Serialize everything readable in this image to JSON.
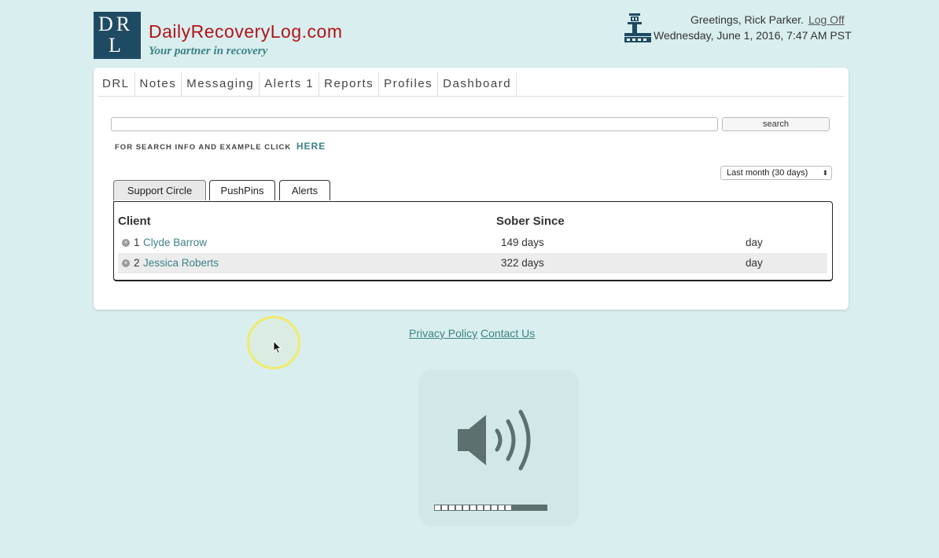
{
  "header": {
    "logo_line1": "DR",
    "logo_line2": "L",
    "brand": "DailyRecoveryLog.com",
    "tagline": "Your partner in recovery",
    "greeting": "Greetings, Rick Parker.",
    "logoff_label": "Log Off",
    "datetime": "Wednesday, June 1, 2016, 7:47 AM PST",
    "icon": "control-tower-icon"
  },
  "nav": {
    "items": [
      {
        "label": "DRL"
      },
      {
        "label": "Notes"
      },
      {
        "label": "Messaging"
      },
      {
        "label": "Alerts 1"
      },
      {
        "label": "Reports"
      },
      {
        "label": "Profiles"
      },
      {
        "label": "Dashboard"
      }
    ]
  },
  "search": {
    "value": "",
    "button_label": "search",
    "info_text": "FOR SEARCH INFO AND EXAMPLE CLICK",
    "info_link": "HERE"
  },
  "period_select": {
    "selected": "Last month (30 days)"
  },
  "tabs": [
    {
      "label": "Support Circle",
      "active": true
    },
    {
      "label": "PushPins",
      "active": false
    },
    {
      "label": "Alerts",
      "active": false
    }
  ],
  "table": {
    "col_client": "Client",
    "col_sober": "Sober Since",
    "rows": [
      {
        "num": "1",
        "name": "Clyde Barrow",
        "sober": "149 days",
        "unit": "day"
      },
      {
        "num": "2",
        "name": "Jessica Roberts",
        "sober": "322 days",
        "unit": "day"
      }
    ]
  },
  "footer": {
    "privacy": "Privacy Policy",
    "contact": "Contact Us"
  },
  "volume": {
    "icon": "speaker-volume-icon",
    "level_segments_filled": 5,
    "total_segments": 16
  },
  "colors": {
    "background": "#d9eeee",
    "brand_red": "#b3141b",
    "teal_link": "#3d8286",
    "logo_navy": "#1f4a63"
  }
}
